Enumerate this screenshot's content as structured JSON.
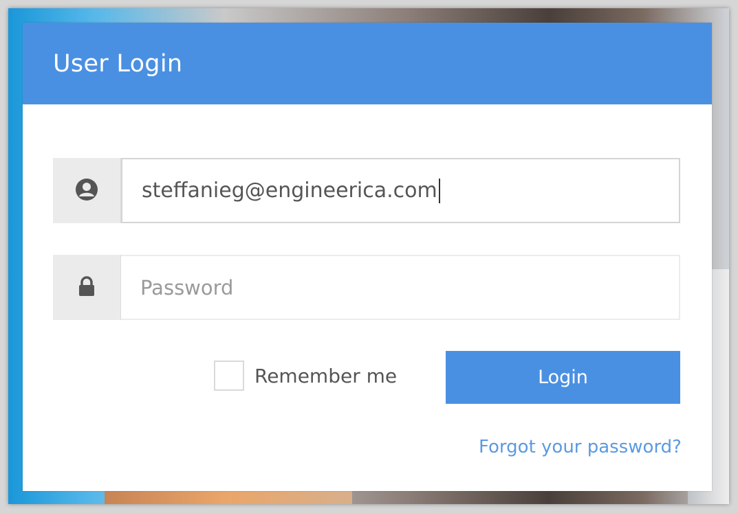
{
  "header": {
    "title": "User Login"
  },
  "form": {
    "email": {
      "value": "steffanieg@engineerica.com",
      "icon": "user-circle-icon"
    },
    "password": {
      "value": "",
      "placeholder": "Password",
      "icon": "lock-icon"
    },
    "remember_me": {
      "label": "Remember me",
      "checked": false
    },
    "login_label": "Login",
    "forgot_label": "Forgot your password?"
  },
  "colors": {
    "accent": "#4a90e2",
    "link": "#5b9ae0",
    "addon_bg": "#ebebeb"
  }
}
